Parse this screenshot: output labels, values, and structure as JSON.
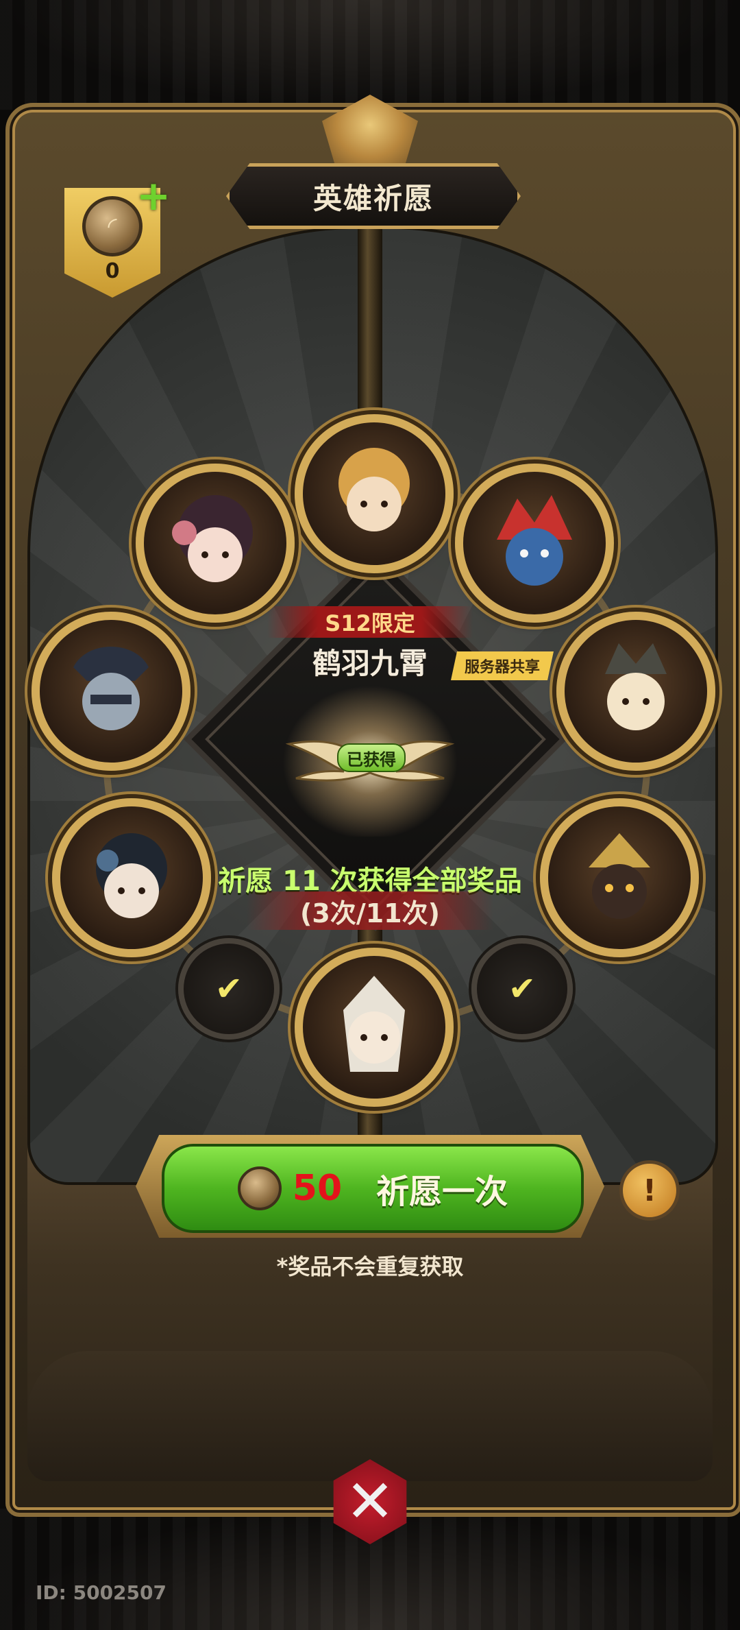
{
  "header": {
    "title": "英雄祈愿"
  },
  "currency": {
    "count": "0",
    "add_symbol": "+",
    "icon": "wish-token-icon"
  },
  "reward": {
    "season_tag": "S12限定",
    "name": "鹤羽九霄",
    "server_tag": "服务器共享",
    "status": "已获得"
  },
  "progress": {
    "line1": "祈愿 11 次获得全部奖品",
    "line2": "(3次/11次)",
    "done": 3,
    "total": 11
  },
  "heroes": [
    {
      "id": "hero-top",
      "color": "#d8a24a"
    },
    {
      "id": "hero-upper-left",
      "color": "#d27a86"
    },
    {
      "id": "hero-upper-right",
      "color": "#c8322e"
    },
    {
      "id": "hero-left",
      "color": "#6a7d92"
    },
    {
      "id": "hero-right",
      "color": "#e6d4a0"
    },
    {
      "id": "hero-lower-left",
      "color": "#4f6f8f"
    },
    {
      "id": "hero-lower-right",
      "color": "#a54e3a"
    },
    {
      "id": "hero-bottom",
      "color": "#e8e2d6"
    }
  ],
  "claimed_rewards": {
    "left_icon": "check-icon",
    "right_icon": "check-icon",
    "check": "✔"
  },
  "action": {
    "cost": "50",
    "label": "祈愿一次",
    "info": "!"
  },
  "note": "*奖品不会重复获取",
  "close_icon": "close-icon",
  "close_symbol": "✕",
  "user_id": "ID: 5002507"
}
